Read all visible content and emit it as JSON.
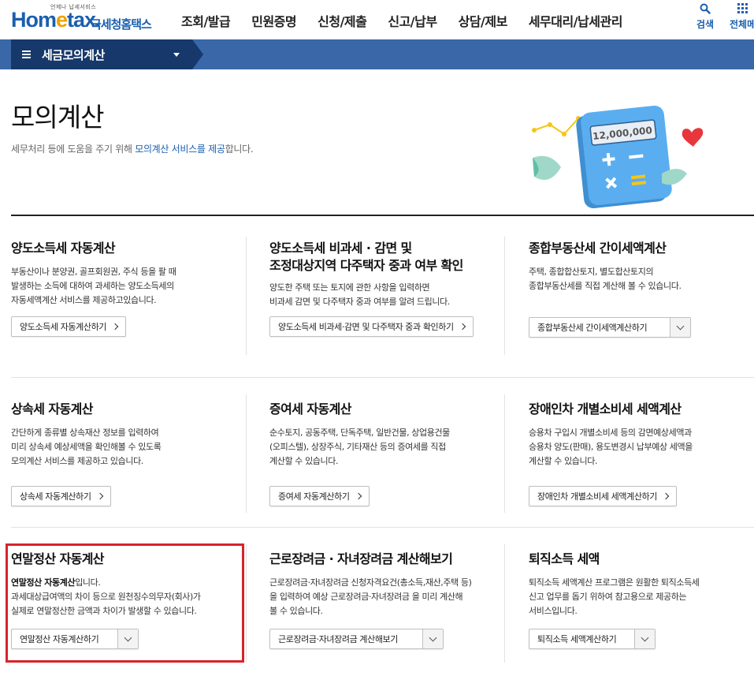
{
  "header": {
    "logo_sub": "언제나 납세서비스",
    "logo_main_a": "Hom",
    "logo_main_e": "e",
    "logo_main_b": "tax.",
    "logo_kr": "국세청홈택스",
    "nav": [
      "조회/발급",
      "민원증명",
      "신청/제출",
      "신고/납부",
      "상담/제보",
      "세무대리/납세관리"
    ],
    "search_label": "검색",
    "all_menu_label": "전체메"
  },
  "menubar": {
    "title": "세금모의계산"
  },
  "page": {
    "title": "모의계산",
    "desc_a": "세무처리 등에 도움을 주기 위해 ",
    "desc_link": "모의계산 서비스를 제공",
    "desc_b": "합니다.",
    "illust_amount": "12,000,000"
  },
  "cards": [
    {
      "title": "양도소득세 자동계산",
      "desc": [
        "부동산이나 분양권, 골프회원권, 주식 등을 팔 때",
        "발생하는 소득에 대하여 과세하는 양도소득세의",
        "자동세액계산 서비스를 제공하고있습니다."
      ],
      "button": "양도소득세 자동계산하기"
    },
    {
      "title_1": "양도소득세 비과세 · 감면 및",
      "title_2": "조정대상지역 다주택자 중과 여부 확인",
      "desc": [
        "양도한 주택 또는 토지에 관한 사항을 입력하면",
        "비과세 감면 및 다주택자 중과 여부를 알려 드립니다."
      ],
      "button": "양도소득세 비과세·감면 및 다주택자 중과 확인하기"
    },
    {
      "title": "종합부동산세 간이세액계산",
      "desc": [
        "주택, 종합합산토지, 별도합산토지의",
        "종합부동산세를 직접 계산해 볼 수 있습니다."
      ],
      "button": "종합부동산세 간이세액계산하기"
    },
    {
      "title": "상속세 자동계산",
      "desc": [
        "간단하게 종류별 상속재산 정보를 입력하여",
        "미리 상속세 예상세액을 확인해볼 수 있도록",
        "모의계산 서비스를 제공하고 있습니다."
      ],
      "button": "상속세 자동계산하기"
    },
    {
      "title": "증여세 자동계산",
      "desc": [
        "순수토지, 공동주택, 단독주택, 일반건물, 상업용건물",
        "(오피스텔), 상장주식, 기타재산 등의 증여세를 직접",
        "계산할 수 있습니다."
      ],
      "button": "증여세 자동계산하기"
    },
    {
      "title": "장애인차 개별소비세 세액계산",
      "desc": [
        "승용차 구입시 개별소비세 등의 감면예상세액과",
        "승용차 양도(판매), 용도변경시 납부예상 세액을",
        "계산할 수 있습니다."
      ],
      "button": "장애인차 개별소비세 세액계산하기"
    },
    {
      "title": "연말정산 자동계산",
      "desc_bold": "연말정산 자동계산",
      "desc_first_rest": "입니다.",
      "desc": [
        "과세대상급여액의 차이 등으로 원천징수의무자(회사)가",
        "실제로 연말정산한 금액과 차이가 발생할 수 있습니다."
      ],
      "button": "연말정산 자동계산하기"
    },
    {
      "title": "근로장려금 · 자녀장려금 계산해보기",
      "desc": [
        "근로장려금·자녀장려금 신청자격요건(총소득,재산,주택 등)",
        "을 입력하여 예상 근로장려금·자녀장려금 을 미리 계산해",
        "볼 수 있습니다."
      ],
      "button": "근로장려금·자녀장려금 계산해보기"
    },
    {
      "title": "퇴직소득 세액",
      "desc": [
        "퇴직소득 세액계산 프로그램은 원활한 퇴직소득세",
        "신고 업무를 돕기 위하여 참고용으로 제공하는",
        "서비스입니다."
      ],
      "button": "퇴직소득 세액계산하기"
    }
  ],
  "colors": {
    "brand": "#1b5fae",
    "menubar": "#3a67a8",
    "menubar_dark": "#17386a",
    "highlight": "#d8232a"
  }
}
